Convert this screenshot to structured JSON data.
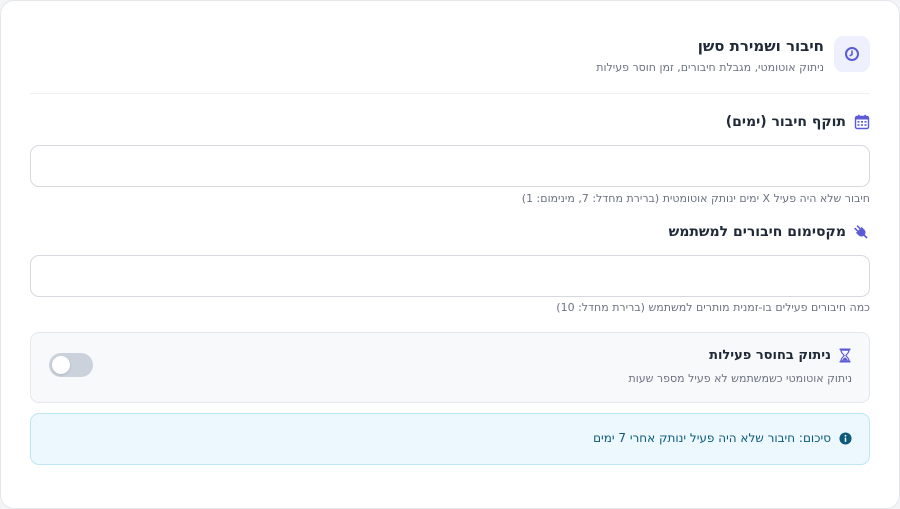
{
  "header": {
    "title": "חיבור ושמירת סשן",
    "subtitle": "ניתוק אוטומטי, מגבלת חיבורים, זמן חוסר פעילות",
    "icon": "clock-icon"
  },
  "session_duration": {
    "label": "תוקף חיבור (ימים)",
    "icon": "calendar-icon",
    "value": "",
    "hint": "חיבור שלא היה פעיל X ימים ינותק אוטומטית (ברירת מחדל: 7, מינימום: 1)"
  },
  "max_sessions": {
    "label": "מקסימום חיבורים למשתמש",
    "icon": "plug-icon",
    "value": "",
    "hint": "כמה חיבורים פעילים בו-זמנית מותרים למשתמש (ברירת מחדל: 10)"
  },
  "idle_logout": {
    "title": "ניתוק בחוסר פעילות",
    "icon": "hourglass-icon",
    "description": "ניתוק אוטומטי כשמשתמש לא פעיל מספר שעות",
    "enabled": false
  },
  "summary": {
    "icon": "info-icon",
    "text": "סיכום: חיבור שלא היה פעיל ינותק אחרי 7 ימים"
  },
  "colors": {
    "accent": "#5b5bd6",
    "toggle_off": "#cbd2dc",
    "summary_bg": "#ecf8fd",
    "summary_text": "#0e5a7a"
  }
}
